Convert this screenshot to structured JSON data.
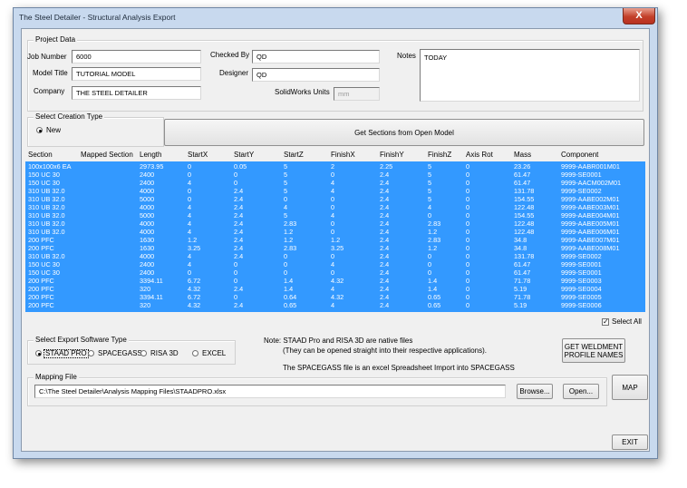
{
  "window": {
    "title": "The Steel Detailer - Structural Analysis Export",
    "close_label": "X"
  },
  "project": {
    "legend": "Project Data",
    "job_number_label": "Job Number",
    "job_number": "6000",
    "model_title_label": "Model Title",
    "model_title": "TUTORIAL MODEL",
    "company_label": "Company",
    "company": "THE STEEL DETAILER",
    "checked_by_label": "Checked By",
    "checked_by": "QD",
    "designer_label": "Designer",
    "designer": "QD",
    "units_label": "SolidWorks Units",
    "units": "mm",
    "notes_label": "Notes",
    "notes": "TODAY"
  },
  "creation": {
    "legend": "Select Creation Type",
    "option_new": "New",
    "get_sections_label": "Get Sections from Open Model"
  },
  "table": {
    "headers": [
      "Section",
      "Mapped Section",
      "Length",
      "StartX",
      "StartY",
      "StartZ",
      "FinishX",
      "FinishY",
      "FinishZ",
      "Axis Rot",
      "Mass",
      "Component"
    ],
    "rows": [
      [
        "100x100x6 EA",
        "",
        "2973.95",
        "0",
        "0.05",
        "5",
        "2",
        "2.25",
        "5",
        "0",
        "23.26",
        "9999-AABR001M01"
      ],
      [
        "150 UC 30",
        "",
        "2400",
        "0",
        "0",
        "5",
        "0",
        "2.4",
        "5",
        "0",
        "61.47",
        "9999-SE0001"
      ],
      [
        "150 UC 30",
        "",
        "2400",
        "4",
        "0",
        "5",
        "4",
        "2.4",
        "5",
        "0",
        "61.47",
        "9999-AACM002M01"
      ],
      [
        "310 UB 32.0",
        "",
        "4000",
        "0",
        "2.4",
        "5",
        "4",
        "2.4",
        "5",
        "0",
        "131.78",
        "9999-SE0002"
      ],
      [
        "310 UB 32.0",
        "",
        "5000",
        "0",
        "2.4",
        "0",
        "0",
        "2.4",
        "5",
        "0",
        "154.55",
        "9999-AABE002M01"
      ],
      [
        "310 UB 32.0",
        "",
        "4000",
        "4",
        "2.4",
        "4",
        "0",
        "2.4",
        "4",
        "0",
        "122.48",
        "9999-AABE003M01"
      ],
      [
        "310 UB 32.0",
        "",
        "5000",
        "4",
        "2.4",
        "5",
        "4",
        "2.4",
        "0",
        "0",
        "154.55",
        "9999-AABE004M01"
      ],
      [
        "310 UB 32.0",
        "",
        "4000",
        "4",
        "2.4",
        "2.83",
        "0",
        "2.4",
        "2.83",
        "0",
        "122.48",
        "9999-AABE005M01"
      ],
      [
        "310 UB 32.0",
        "",
        "4000",
        "4",
        "2.4",
        "1.2",
        "0",
        "2.4",
        "1.2",
        "0",
        "122.48",
        "9999-AABE006M01"
      ],
      [
        "200 PFC",
        "",
        "1630",
        "1.2",
        "2.4",
        "1.2",
        "1.2",
        "2.4",
        "2.83",
        "0",
        "34.8",
        "9999-AABE007M01"
      ],
      [
        "200 PFC",
        "",
        "1630",
        "3.25",
        "2.4",
        "2.83",
        "3.25",
        "2.4",
        "1.2",
        "0",
        "34.8",
        "9999-AABE008M01"
      ],
      [
        "310 UB 32.0",
        "",
        "4000",
        "4",
        "2.4",
        "0",
        "0",
        "2.4",
        "0",
        "0",
        "131.78",
        "9999-SE0002"
      ],
      [
        "150 UC 30",
        "",
        "2400",
        "4",
        "0",
        "0",
        "4",
        "2.4",
        "0",
        "0",
        "61.47",
        "9999-SE0001"
      ],
      [
        "150 UC 30",
        "",
        "2400",
        "0",
        "0",
        "0",
        "0",
        "2.4",
        "0",
        "0",
        "61.47",
        "9999-SE0001"
      ],
      [
        "200 PFC",
        "",
        "3394.11",
        "6.72",
        "0",
        "1.4",
        "4.32",
        "2.4",
        "1.4",
        "0",
        "71.78",
        "9999-SE0003"
      ],
      [
        "200 PFC",
        "",
        "320",
        "4.32",
        "2.4",
        "1.4",
        "4",
        "2.4",
        "1.4",
        "0",
        "5.19",
        "9999-SE0004"
      ],
      [
        "200 PFC",
        "",
        "3394.11",
        "6.72",
        "0",
        "0.64",
        "4.32",
        "2.4",
        "0.65",
        "0",
        "71.78",
        "9999-SE0005"
      ],
      [
        "200 PFC",
        "",
        "320",
        "4.32",
        "2.4",
        "0.65",
        "4",
        "2.4",
        "0.65",
        "0",
        "5.19",
        "9999-SE0006"
      ]
    ]
  },
  "select_all_label": "Select All",
  "export": {
    "legend": "Select Export Software Type",
    "options": [
      "STAAD PRO",
      "SPACEGASS",
      "RISA 3D",
      "EXCEL"
    ],
    "note_line1": "Note: STAAD Pro and RISA 3D are native files",
    "note_line2": "(They can be opened straight into their respective applications).",
    "note_line3": "The SPACEGASS file is an excel Spreadsheet Import into SPACEGASS"
  },
  "weldment_button": {
    "line1": "GET WELDMENT",
    "line2": "PROFILE NAMES"
  },
  "mapping": {
    "legend": "Mapping File",
    "path": "C:\\The Steel Detailer\\Analysis Mapping Files\\STAADPRO.xlsx",
    "browse_label": "Browse...",
    "open_label": "Open..."
  },
  "map_button_label": "MAP",
  "exit_button_label": "EXIT",
  "colors": {
    "selection": "#3399ff",
    "window_frame": "#c8d9ee",
    "close": "#c3402a"
  }
}
